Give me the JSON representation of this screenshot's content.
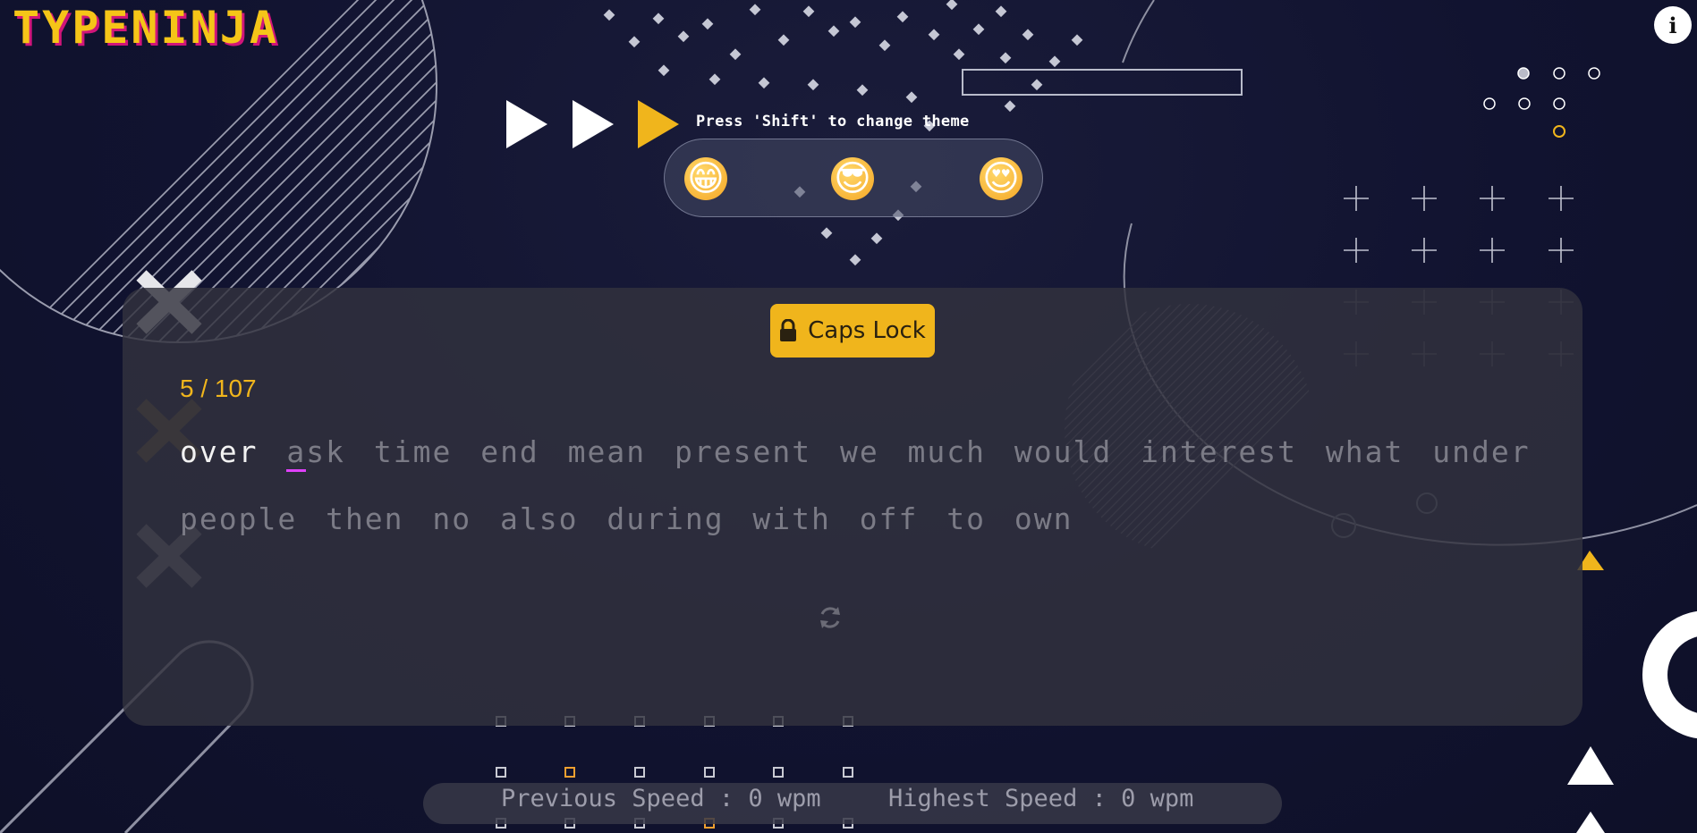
{
  "app": {
    "logo": "TYPENINJA",
    "info_label": "i"
  },
  "theme": {
    "hint": "Press 'Shift' to change theme",
    "emojis": [
      "😁",
      "😎",
      "😍"
    ],
    "active_play_index": 2
  },
  "caps_lock": {
    "label": "Caps Lock",
    "icon": "lock-icon"
  },
  "test": {
    "progress": "5 / 107",
    "typed_word": "over",
    "current_word_first": "a",
    "current_word_rest": "sk",
    "line1_rest": "time end mean present we much would interest what under",
    "line2": "people then no also during with off to own"
  },
  "stats": {
    "previous_speed": "Previous Speed : 0 wpm",
    "highest_speed": "Highest Speed : 0 wpm"
  },
  "colors": {
    "accent": "#f0b51c",
    "logo_shadow": "#d0157a",
    "cursor": "#e040fb",
    "background": "#111330"
  }
}
